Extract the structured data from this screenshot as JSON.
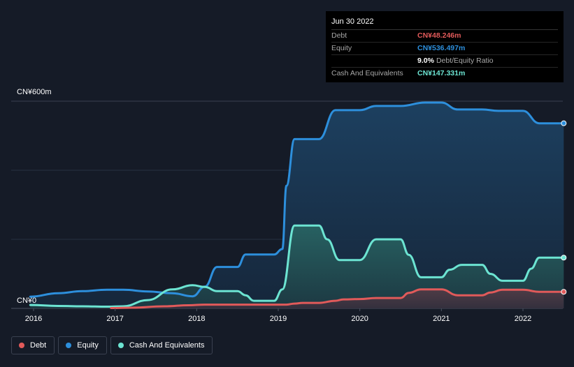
{
  "chart_data": {
    "type": "area",
    "x_ticks": [
      "2016",
      "2017",
      "2018",
      "2019",
      "2020",
      "2021",
      "2022"
    ],
    "y_ticks": [
      "CN¥0",
      "CN¥600m"
    ],
    "ylim": [
      0,
      600
    ],
    "xlim": [
      2015.96,
      2022.5
    ],
    "grid": true,
    "legend_position": "bottom-left",
    "series": [
      {
        "name": "Equity",
        "color": "#2d8fdc",
        "x": [
          2015.96,
          2016.3,
          2016.6,
          2016.9,
          2017.1,
          2017.4,
          2017.7,
          2017.95,
          2018.1,
          2018.25,
          2018.5,
          2018.6,
          2018.7,
          2018.95,
          2019.05,
          2019.1,
          2019.2,
          2019.5,
          2019.7,
          2019.75,
          2020.0,
          2020.2,
          2020.5,
          2020.8,
          2021.0,
          2021.2,
          2021.5,
          2021.7,
          2022.0,
          2022.2,
          2022.5
        ],
        "values": [
          34,
          44,
          50,
          54,
          54,
          49,
          44,
          35,
          63,
          120,
          120,
          156,
          156,
          156,
          172,
          355,
          490,
          490,
          574,
          574,
          574,
          586,
          586,
          596,
          596,
          576,
          576,
          572,
          572,
          536,
          536
        ]
      },
      {
        "name": "Cash And Equivalents",
        "color": "#6ce4d2",
        "x": [
          2015.96,
          2016.3,
          2016.6,
          2016.9,
          2017.1,
          2017.4,
          2017.7,
          2017.95,
          2018.1,
          2018.25,
          2018.5,
          2018.6,
          2018.7,
          2018.95,
          2019.05,
          2019.2,
          2019.5,
          2019.6,
          2019.75,
          2020.0,
          2020.2,
          2020.5,
          2020.6,
          2020.75,
          2021.0,
          2021.1,
          2021.25,
          2021.5,
          2021.6,
          2021.75,
          2022.0,
          2022.1,
          2022.2,
          2022.5
        ],
        "values": [
          10,
          7,
          6,
          5,
          6,
          24,
          55,
          67,
          62,
          50,
          50,
          38,
          22,
          22,
          55,
          240,
          240,
          200,
          140,
          140,
          200,
          200,
          155,
          90,
          90,
          112,
          126,
          126,
          100,
          80,
          80,
          115,
          147,
          147
        ]
      },
      {
        "name": "Debt",
        "color": "#e15a5a",
        "x": [
          2016.95,
          2017.2,
          2017.6,
          2017.9,
          2018.1,
          2018.7,
          2019.1,
          2019.2,
          2019.3,
          2019.5,
          2019.7,
          2019.8,
          2020.0,
          2020.2,
          2020.5,
          2020.6,
          2020.75,
          2021.0,
          2021.2,
          2021.5,
          2021.6,
          2021.75,
          2022.0,
          2022.2,
          2022.5
        ],
        "values": [
          1,
          2,
          6,
          9,
          11,
          11,
          11,
          14,
          16,
          16,
          22,
          26,
          27,
          30,
          30,
          45,
          55,
          55,
          38,
          38,
          46,
          54,
          54,
          48,
          48
        ]
      }
    ]
  },
  "tooltip": {
    "date": "Jun 30 2022",
    "rows": [
      {
        "label": "Debt",
        "value": "CN¥48.246m",
        "color": "#e15a5a"
      },
      {
        "label": "Equity",
        "value": "CN¥536.497m",
        "color": "#2d8fdc"
      },
      {
        "label": "",
        "value": "9.0%",
        "sub": "Debt/Equity Ratio",
        "color": "#ffffff"
      },
      {
        "label": "Cash And Equivalents",
        "value": "CN¥147.331m",
        "color": "#6ce4d2"
      }
    ]
  },
  "legend": {
    "items": [
      {
        "label": "Debt",
        "color": "#e15a5a"
      },
      {
        "label": "Equity",
        "color": "#2d8fdc"
      },
      {
        "label": "Cash And Equivalents",
        "color": "#6ce4d2"
      }
    ]
  }
}
